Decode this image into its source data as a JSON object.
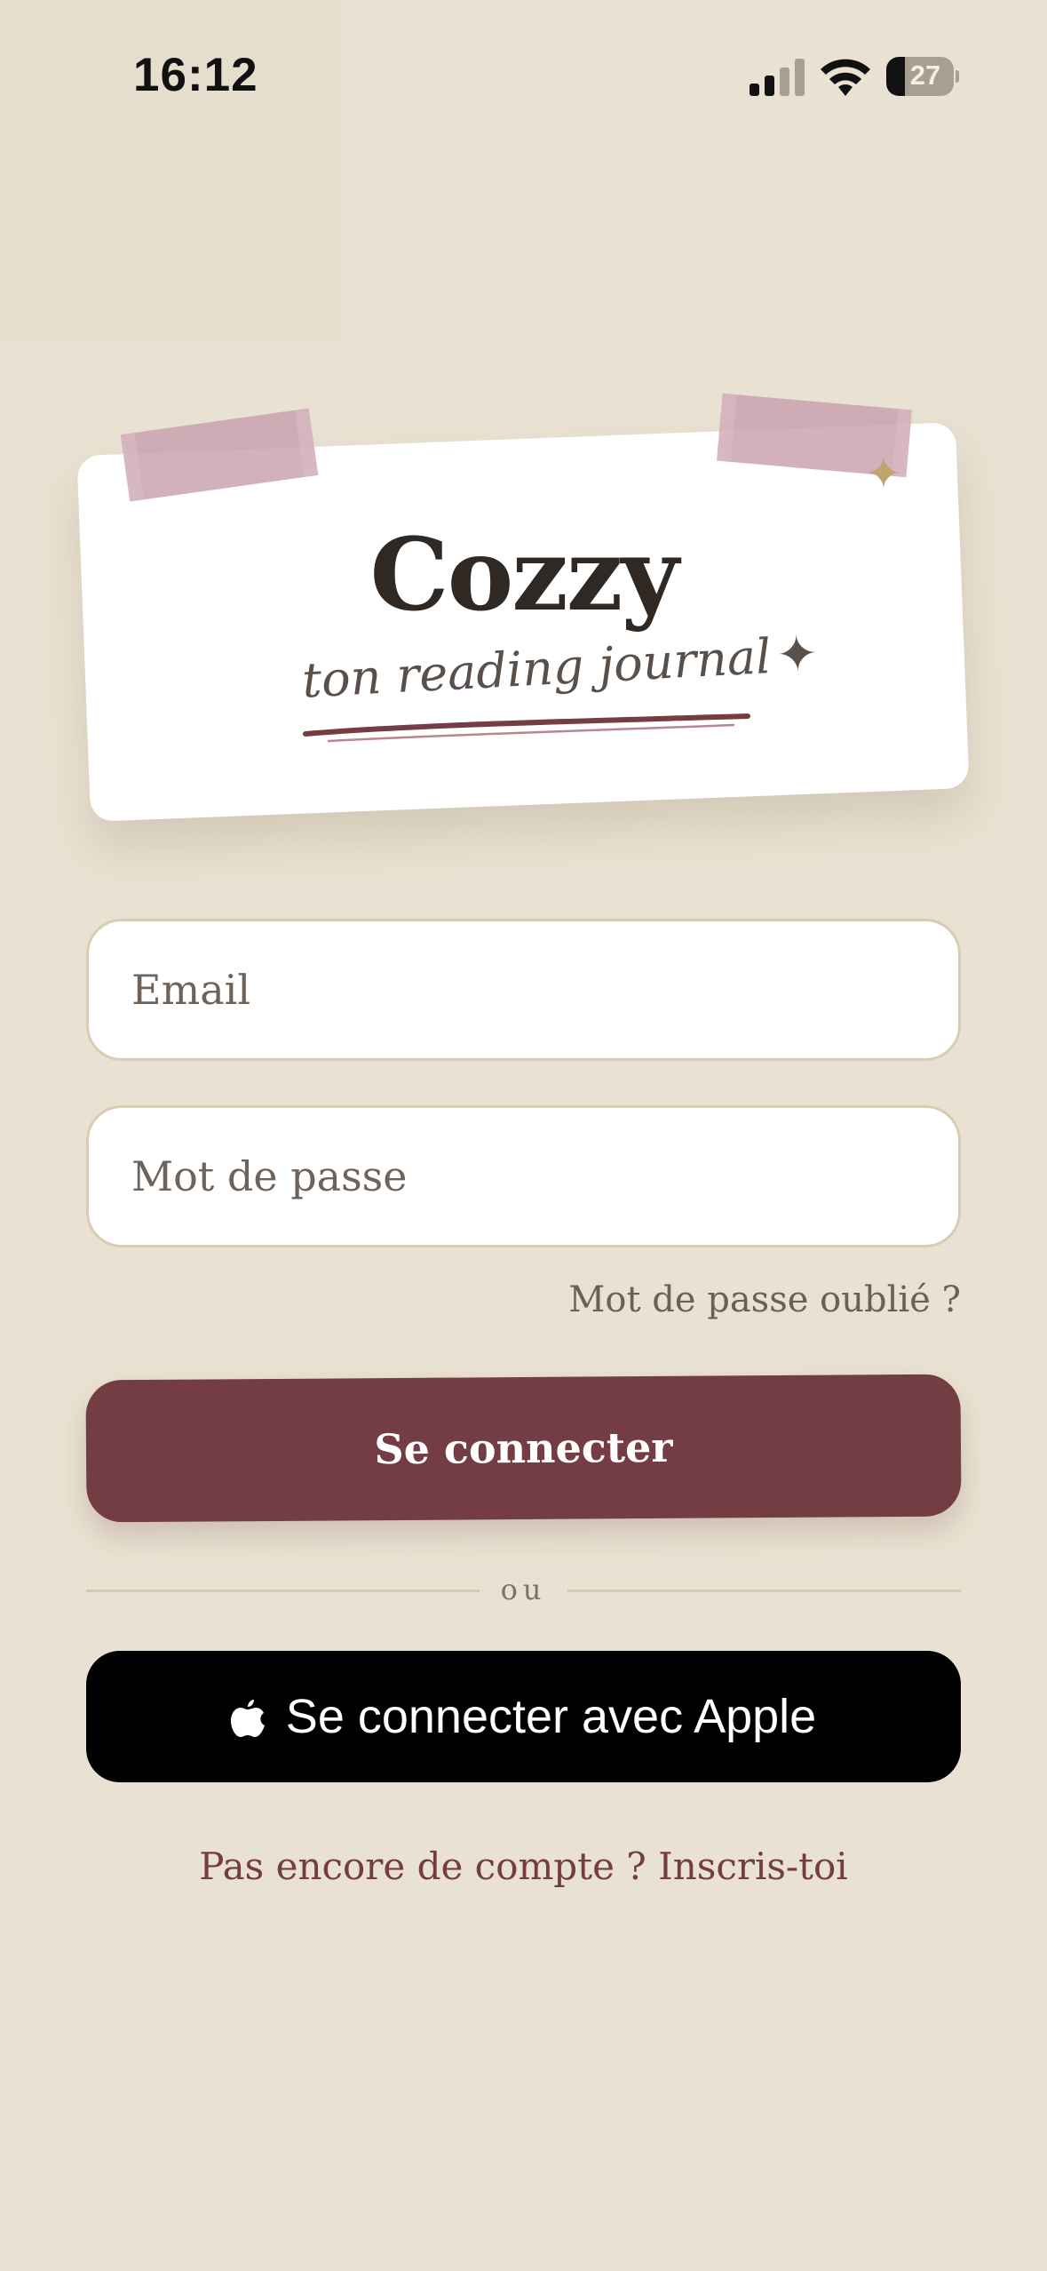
{
  "status_bar": {
    "time": "16:12",
    "battery_level": "27",
    "battery_fraction": 0.27,
    "icons": [
      "signal-icon",
      "wifi-icon",
      "battery-icon"
    ]
  },
  "logo": {
    "title": "Cozzy",
    "tagline": "ton reading journal",
    "tagline_icon": "sparkle-icon"
  },
  "form": {
    "email_placeholder": "Email",
    "password_placeholder": "Mot de passe",
    "forgot_password": "Mot de passe oublié ?",
    "login_button": "Se connecter",
    "divider": "ou",
    "apple_button": "Se connecter avec Apple",
    "signup_link": "Pas encore de compte ? Inscris-toi"
  },
  "colors": {
    "background": "#E9E1D1",
    "accent": "#743C43",
    "card": "#FFFFFF",
    "tape": "#C8A0AE",
    "sparkle_gold": "#C0A46A"
  }
}
